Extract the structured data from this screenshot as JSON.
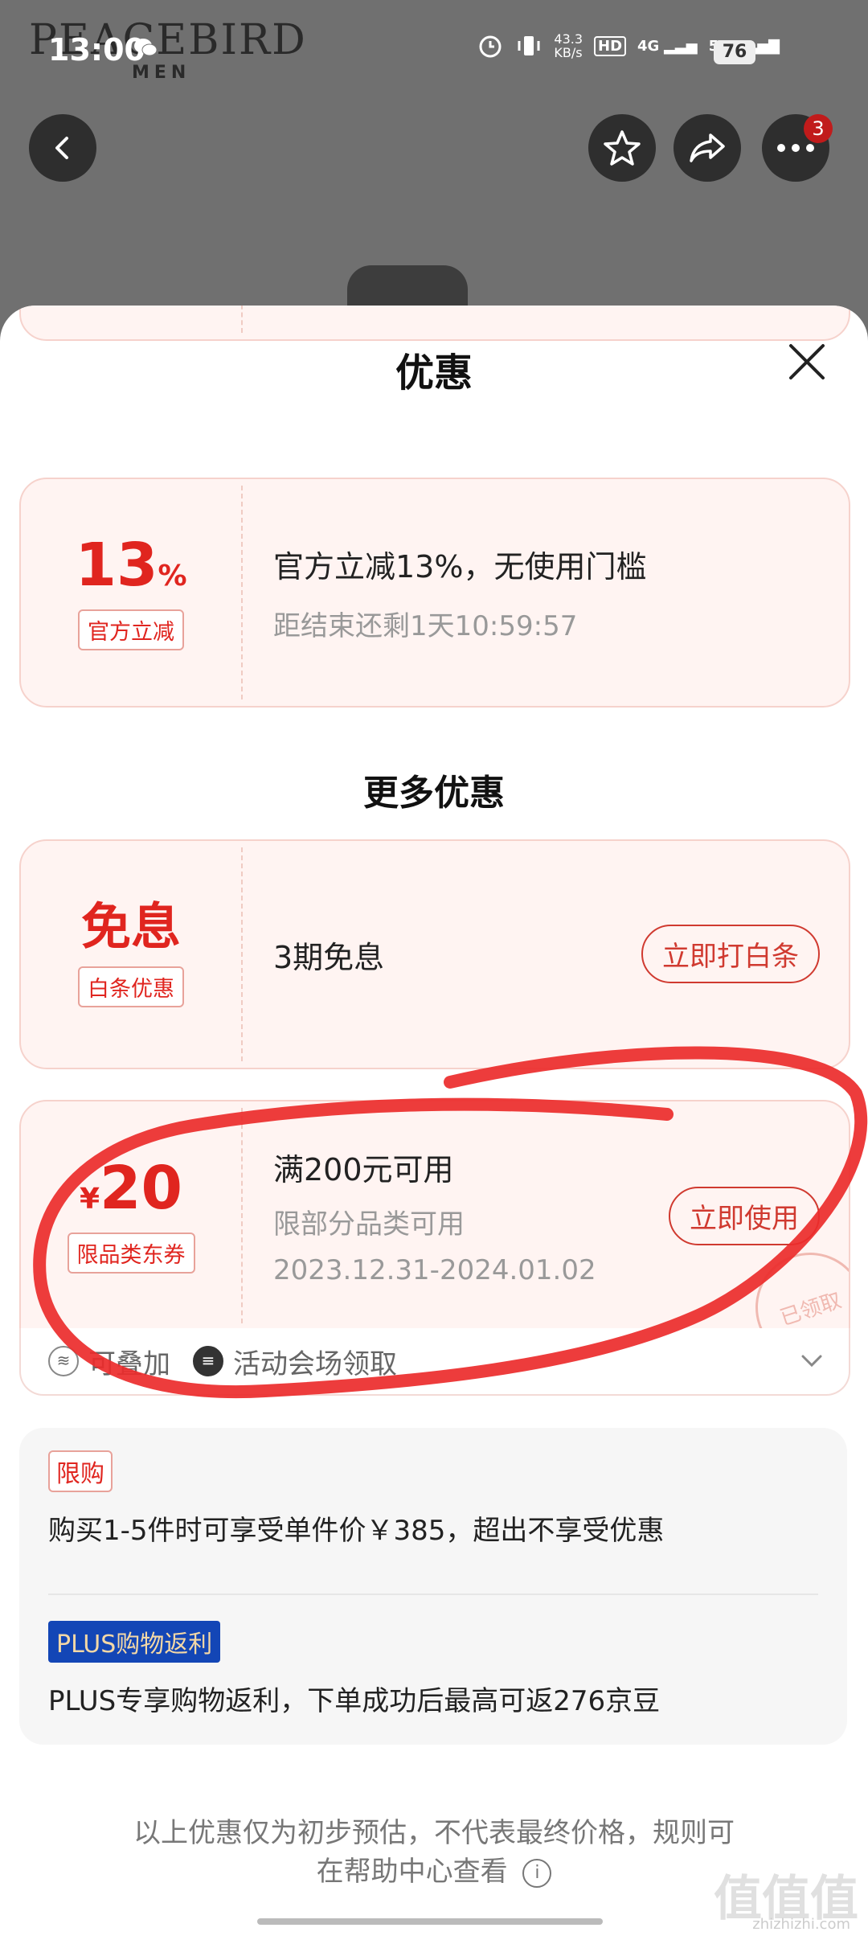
{
  "status_bar": {
    "time": "13:00",
    "net_speed": "43.3\nKB/s",
    "hd": "HD",
    "signal_4g": "4G",
    "signal_5g": "5G",
    "battery": "76"
  },
  "background": {
    "brand": "PEACEBIRD",
    "brand_sub": "MEN",
    "more_badge": "3"
  },
  "sheet": {
    "title": "优惠"
  },
  "coupons": [
    {
      "big": "13",
      "big_unit": "%",
      "tag": "官方立减",
      "line1": "官方立减13%，无使用门槛",
      "line2": "距结束还剩1天10:59:57"
    }
  ],
  "more_title": "更多优惠",
  "more": [
    {
      "big": "免息",
      "tag": "白条优惠",
      "line1": "3期免息",
      "button": "立即打白条"
    },
    {
      "big_prefix": "¥",
      "big": "20",
      "tag": "限品类东券",
      "line1": "满200元可用",
      "line2": "限部分品类可用",
      "line3": "2023.12.31-2024.01.02",
      "button": "立即使用",
      "stamp": "已领取",
      "stackable": "可叠加",
      "source": "活动会场领取"
    }
  ],
  "info": {
    "limit_label": "限购",
    "limit_text": "购买1-5件时可享受单件价￥385，超出不享受优惠",
    "plus_label": "PLUS购物返利",
    "plus_text": "PLUS专享购物返利，下单成功后最高可返276京豆"
  },
  "footer": {
    "line1": "以上优惠仅为初步预估，不代表最终价格，规则可",
    "line2": "在帮助中心查看"
  },
  "watermark": {
    "main": "值值值",
    "sub": "zhizhizhi.com"
  },
  "colors": {
    "accent_red": "#e0251f",
    "card_bg": "#fff4f2",
    "plus_blue": "#1346b6",
    "annotation_red": "#ec2b2b"
  }
}
